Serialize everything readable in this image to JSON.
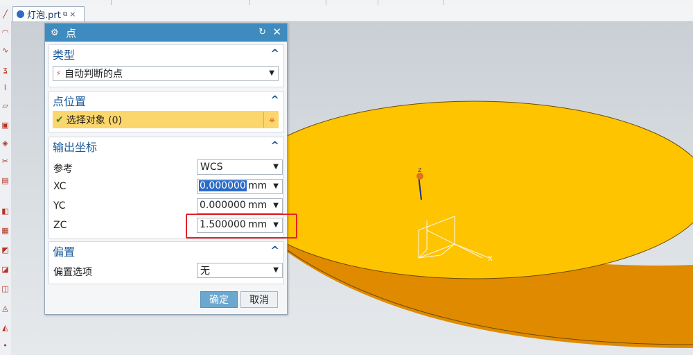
{
  "tab": {
    "title": "灯泡.prt",
    "pin": "⧉",
    "close": "×"
  },
  "dialog": {
    "title": "点",
    "sections": {
      "type": {
        "header": "类型",
        "value": "自动判断的点"
      },
      "point_location": {
        "header": "点位置",
        "select_object": "选择对象 (0)"
      },
      "output_coords": {
        "header": "输出坐标",
        "reference_label": "参考",
        "reference_value": "WCS",
        "xc_label": "XC",
        "xc_value": "0.000000",
        "yc_label": "YC",
        "yc_value": "0.000000",
        "zc_label": "ZC",
        "zc_value": "1.500000",
        "unit": "mm"
      },
      "offset": {
        "header": "偏置",
        "option_label": "偏置选项",
        "option_value": "无"
      }
    },
    "ok_label": "确定",
    "cancel_label": "取消"
  },
  "viewport": {
    "axis_label": "X",
    "cylinder_color": "#FFC400",
    "cylinder_side_color": "#E08A00"
  },
  "colors": {
    "title_bar": "#3E8BBF",
    "highlight": "#FBD66C",
    "annotation": "#E0242A"
  }
}
